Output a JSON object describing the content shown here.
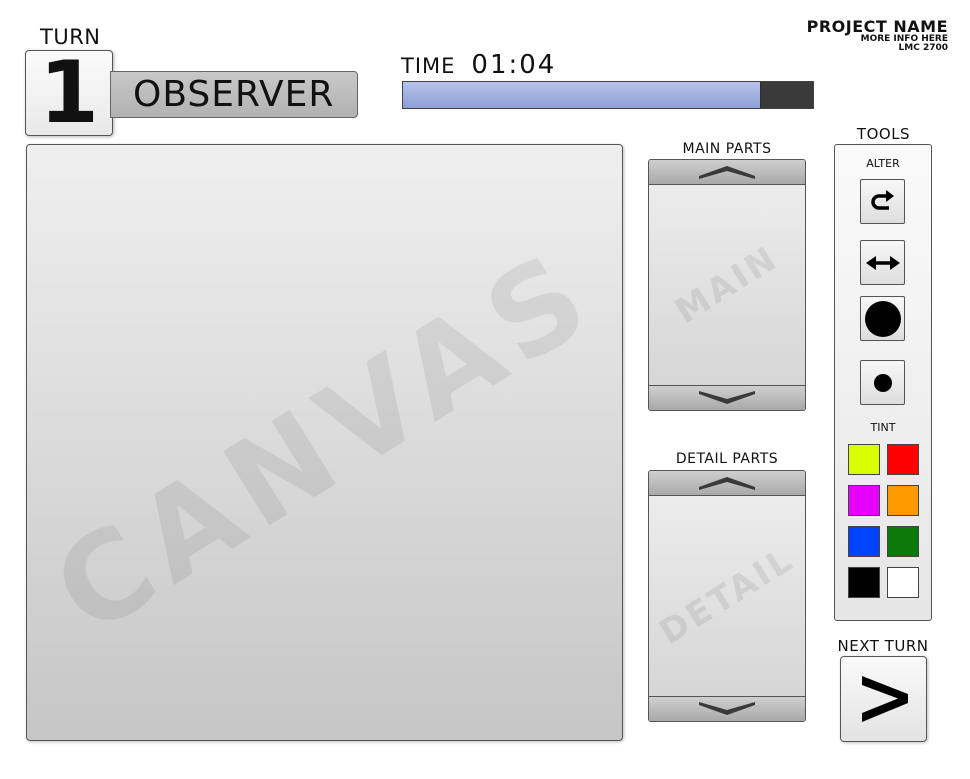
{
  "header": {
    "turn_label": "TURN",
    "turn_number": "1",
    "role": "OBSERVER",
    "time_label": "TIME",
    "time_value": "01:04",
    "time_progress": 0.87
  },
  "project": {
    "name": "PROJECT NAME",
    "info": "MORE INFO HERE",
    "code": "LMC 2700"
  },
  "canvas": {
    "watermark": "CANVAS"
  },
  "main_parts": {
    "title": "MAIN PARTS",
    "watermark": "MAIN"
  },
  "detail_parts": {
    "title": "DETAIL PARTS",
    "watermark": "DETAIL"
  },
  "tools": {
    "title": "TOOLS",
    "alter_label": "ALTER",
    "alter_tools": [
      "rotate-icon",
      "flip-horizontal-icon",
      "large-circle-icon",
      "small-circle-icon"
    ],
    "tint_label": "TINT",
    "tints": [
      "#d7ff00",
      "#ff0000",
      "#e600ff",
      "#ff9a00",
      "#0044ff",
      "#0b7a0b",
      "#000000",
      "#ffffff"
    ]
  },
  "next_turn": {
    "label": "NEXT TURN",
    "icon": "chevron-right-icon"
  }
}
